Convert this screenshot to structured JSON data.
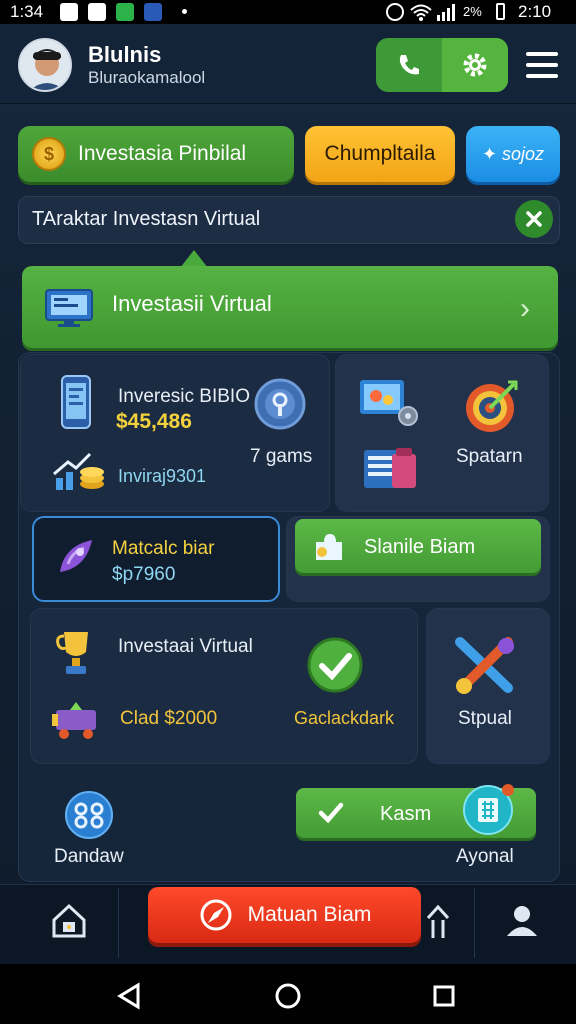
{
  "status_bar": {
    "time_left": "1:34",
    "time_right": "2:10",
    "battery": "2%"
  },
  "header": {
    "username": "Blulnis",
    "subtitle": "Bluraokamalool"
  },
  "tabs": {
    "tab1": "Investasia Pinbilal",
    "tab2": "Chumpltaila",
    "tab3": "✦ sojoz"
  },
  "infobar": {
    "text": "TAraktar Investasn Virtual"
  },
  "banner": {
    "label": "Investasii Virtual"
  },
  "cards": {
    "investor_title": "Inveresic BIBIO",
    "investor_amount": "$45,486",
    "investor_sub": "Inviraj9301",
    "games": "7 gams",
    "spatarn": "Spatarn",
    "malcalc_title": "Matcalc biar",
    "malcalc_amount": "$p7960",
    "slanile": "Slanile Biam",
    "virtual_title": "Investaai Virtual",
    "virtual_amount": "Clad $2000",
    "checkback": "Gaclackdark",
    "stpual": "Stpual",
    "dandaw": "Dandaw",
    "kasm": "Kasm",
    "ayonal": "Ayonal"
  },
  "bottom_nav": {
    "main_action": "Matuan Biam"
  },
  "colors": {
    "green": "#4fa73a",
    "orange": "#f2a516",
    "blue": "#1b8de4",
    "red": "#e03218",
    "panel": "#1b2b41"
  }
}
